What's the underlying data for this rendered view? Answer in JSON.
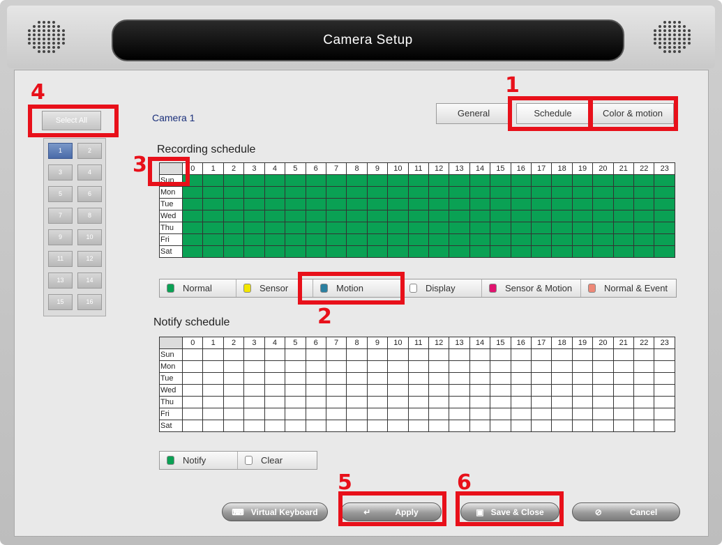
{
  "window": {
    "title": "Camera Setup"
  },
  "sidebar": {
    "select_all": "Select All",
    "cameras": [
      "1",
      "2",
      "3",
      "4",
      "5",
      "6",
      "7",
      "8",
      "9",
      "10",
      "11",
      "12",
      "13",
      "14",
      "15",
      "16"
    ],
    "selected": "1"
  },
  "camera_label": "Camera 1",
  "tabs": [
    "General",
    "Schedule",
    "Color & motion"
  ],
  "active_tab": "Schedule",
  "recording": {
    "title": "Recording schedule",
    "hours": [
      "0",
      "1",
      "2",
      "3",
      "4",
      "5",
      "6",
      "7",
      "8",
      "9",
      "10",
      "11",
      "12",
      "13",
      "14",
      "15",
      "16",
      "17",
      "18",
      "19",
      "20",
      "21",
      "22",
      "23"
    ],
    "days": [
      "Sun",
      "Mon",
      "Tue",
      "Wed",
      "Thu",
      "Fri",
      "Sat"
    ],
    "fill_color": "#0aa154",
    "legend": [
      {
        "label": "Normal",
        "color": "#0aa154"
      },
      {
        "label": "Sensor",
        "color": "#f2e600"
      },
      {
        "label": "Motion",
        "color": "#2b7fa0"
      },
      {
        "label": "Display",
        "color": "#ffffff"
      },
      {
        "label": "Sensor & Motion",
        "color": "#e0136e"
      },
      {
        "label": "Normal & Event",
        "color": "#ee8877"
      }
    ]
  },
  "notify": {
    "title": "Notify schedule",
    "hours": [
      "0",
      "1",
      "2",
      "3",
      "4",
      "5",
      "6",
      "7",
      "8",
      "9",
      "10",
      "11",
      "12",
      "13",
      "14",
      "15",
      "16",
      "17",
      "18",
      "19",
      "20",
      "21",
      "22",
      "23"
    ],
    "days": [
      "Sun",
      "Mon",
      "Tue",
      "Wed",
      "Thu",
      "Fri",
      "Sat"
    ],
    "legend": [
      {
        "label": "Notify",
        "color": "#0aa154"
      },
      {
        "label": "Clear",
        "color": "#ffffff"
      }
    ]
  },
  "buttons": {
    "virtual_keyboard": "Virtual Keyboard",
    "apply": "Apply",
    "save_close": "Save & Close",
    "cancel": "Cancel"
  },
  "annotations": [
    "1",
    "2",
    "3",
    "4",
    "5",
    "6"
  ],
  "annotation_color": "#e8101a"
}
